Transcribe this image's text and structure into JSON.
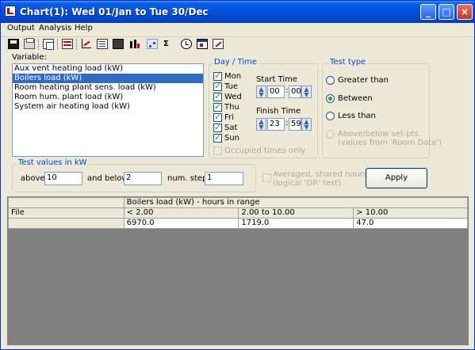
{
  "window": {
    "title": "Chart(1): Wed 01/Jan to Tue 30/Dec",
    "controls": {
      "minimize": "_",
      "maximize": "□",
      "close": "×"
    }
  },
  "menu": [
    "Output",
    "Analysis",
    "Help"
  ],
  "toolbar_icons": [
    "save-icon",
    "print-icon",
    "copy-icon",
    "table-icon",
    "line-chart-icon",
    "list-icon",
    "export-icon",
    "bar-chart-icon",
    "scatter-icon",
    "sum-icon",
    "clock-icon",
    "window-icon",
    "edit-chart-icon"
  ],
  "variable": {
    "label": "Variable:",
    "items": [
      "Aux vent heating load (kW)",
      "Boilers load (kW)",
      "Room heating plant sens. load (kW)",
      "Room hum. plant load (kW)",
      "System air heating load (kW)"
    ],
    "selected_index": 1
  },
  "day_time": {
    "title": "Day / Time",
    "days": [
      {
        "label": "Mon",
        "checked": true
      },
      {
        "label": "Tue",
        "checked": true
      },
      {
        "label": "Wed",
        "checked": true
      },
      {
        "label": "Thu",
        "checked": true
      },
      {
        "label": "Fri",
        "checked": true
      },
      {
        "label": "Sat",
        "checked": true
      },
      {
        "label": "Sun",
        "checked": true
      }
    ],
    "start_time_label": "Start Time",
    "start_hour": "00",
    "start_min": "00",
    "finish_time_label": "Finish Time",
    "finish_hour": "23",
    "finish_min": "59",
    "colon": ":",
    "occupied_label": "Occupied times only"
  },
  "test_type": {
    "title": "Test type",
    "options": [
      {
        "label": "Greater than",
        "checked": false
      },
      {
        "label": "Between",
        "checked": true
      },
      {
        "label": "Less than",
        "checked": false
      }
    ],
    "above_below_line1": "Above/below set-pts.",
    "above_below_line2": "(values from 'Room Data')"
  },
  "test_values": {
    "title": "Test values in kW",
    "above_label": "above",
    "above_value": "10",
    "below_label": "and below",
    "below_value": "2",
    "steps_label": "num. steps",
    "steps_value": "1"
  },
  "averaged": {
    "line1": "Averaged, shared hours",
    "line2": "(logical 'OR' test)"
  },
  "apply_label": "Apply",
  "grid": {
    "caption": "Boilers load (kW) - hours in range",
    "row_label": "File",
    "columns": [
      "< 2.00",
      "2.00 to 10.00",
      "> 10.00"
    ],
    "values": [
      "6970.0",
      "1719.0",
      "47.0"
    ]
  }
}
